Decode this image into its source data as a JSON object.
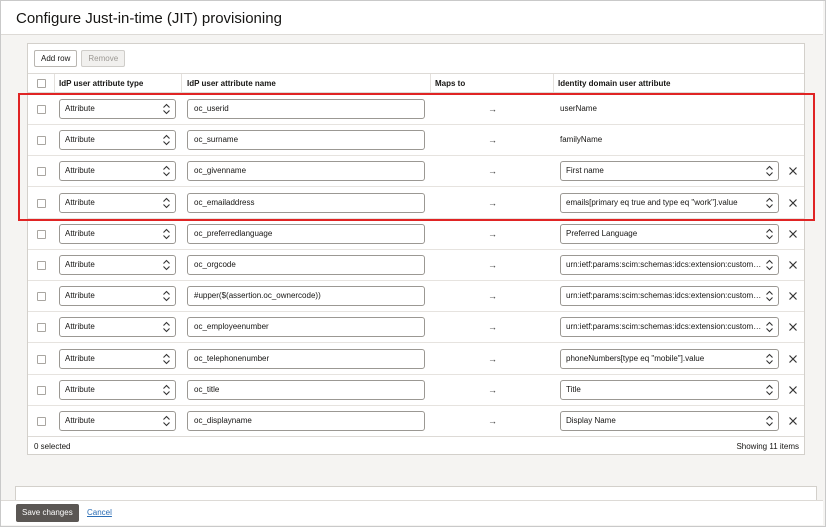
{
  "title": "Configure Just-in-time (JIT) provisioning",
  "toolbar": {
    "add_row": "Add row",
    "remove": "Remove"
  },
  "columns": {
    "type": "IdP user attribute type",
    "name": "IdP user attribute name",
    "maps": "Maps to",
    "identity": "Identity domain user attribute"
  },
  "rows": [
    {
      "type": "Attribute",
      "name": "oc_userid",
      "maps": "→",
      "identity": "userName",
      "identity_editable": false
    },
    {
      "type": "Attribute",
      "name": "oc_surname",
      "maps": "→",
      "identity": "familyName",
      "identity_editable": false
    },
    {
      "type": "Attribute",
      "name": "oc_givenname",
      "maps": "→",
      "identity": "First name",
      "identity_editable": true
    },
    {
      "type": "Attribute",
      "name": "oc_emailaddress",
      "maps": "→",
      "identity": "emails[primary eq true and type eq \"work\"].value",
      "identity_editable": true
    },
    {
      "type": "Attribute",
      "name": "oc_preferredlanguage",
      "maps": "→",
      "identity": "Preferred Language",
      "identity_editable": true
    },
    {
      "type": "Attribute",
      "name": "oc_orgcode",
      "maps": "→",
      "identity": "urn:ietf:params:scim:schemas:idcs:extension:custom:...",
      "identity_editable": true
    },
    {
      "type": "Attribute",
      "name": "#upper($(assertion.oc_ownercode))",
      "maps": "→",
      "identity": "urn:ietf:params:scim:schemas:idcs:extension:custom:...",
      "identity_editable": true
    },
    {
      "type": "Attribute",
      "name": "oc_employeenumber",
      "maps": "→",
      "identity": "urn:ietf:params:scim:schemas:idcs:extension:custom:...",
      "identity_editable": true
    },
    {
      "type": "Attribute",
      "name": "oc_telephonenumber",
      "maps": "→",
      "identity": "phoneNumbers[type eq \"mobile\"].value",
      "identity_editable": true
    },
    {
      "type": "Attribute",
      "name": "oc_title",
      "maps": "→",
      "identity": "Title",
      "identity_editable": true
    },
    {
      "type": "Attribute",
      "name": "oc_displayname",
      "maps": "→",
      "identity": "Display Name",
      "identity_editable": true
    }
  ],
  "footer": {
    "selected": "0 selected",
    "showing": "Showing 11 items"
  },
  "actions": {
    "save": "Save changes",
    "cancel": "Cancel"
  },
  "colors": {
    "highlight": "#e02424",
    "link": "#2a6db5",
    "primary_button": "#5b5754"
  }
}
